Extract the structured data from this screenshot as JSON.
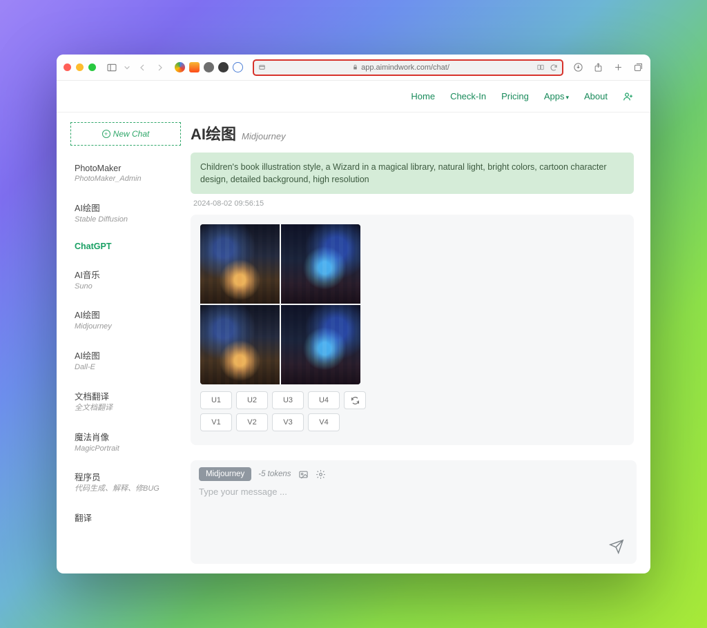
{
  "browser": {
    "url": "app.aimindwork.com/chat/"
  },
  "nav": {
    "home": "Home",
    "checkin": "Check-In",
    "pricing": "Pricing",
    "apps": "Apps",
    "about": "About"
  },
  "sidebar": {
    "newchat": "New Chat",
    "items": [
      {
        "title": "PhotoMaker",
        "sub": "PhotoMaker_Admin"
      },
      {
        "title": "AI绘图",
        "sub": "Stable Diffusion"
      },
      {
        "title": "ChatGPT",
        "sub": ""
      },
      {
        "title": "AI音乐",
        "sub": "Suno"
      },
      {
        "title": "AI绘图",
        "sub": "Midjourney"
      },
      {
        "title": "AI绘图",
        "sub": "Dall-E"
      },
      {
        "title": "文档翻译",
        "sub": "全文档翻译"
      },
      {
        "title": "魔法肖像",
        "sub": "MagicPortrait"
      },
      {
        "title": "程序员",
        "sub": "代码生成、解释、修BUG"
      },
      {
        "title": "翻译",
        "sub": ""
      }
    ]
  },
  "header": {
    "title": "AI绘图",
    "subtitle": "Midjourney"
  },
  "prompt": "Children's book illustration style, a Wizard in a magical library, natural light, bright colors, cartoon character design, detailed background, high resolution",
  "timestamp": "2024-08-02 09:56:15",
  "buttons": {
    "u": [
      "U1",
      "U2",
      "U3",
      "U4"
    ],
    "v": [
      "V1",
      "V2",
      "V3",
      "V4"
    ]
  },
  "compose": {
    "model": "Midjourney",
    "tokens": "-5 tokens",
    "placeholder": "Type your message ..."
  }
}
